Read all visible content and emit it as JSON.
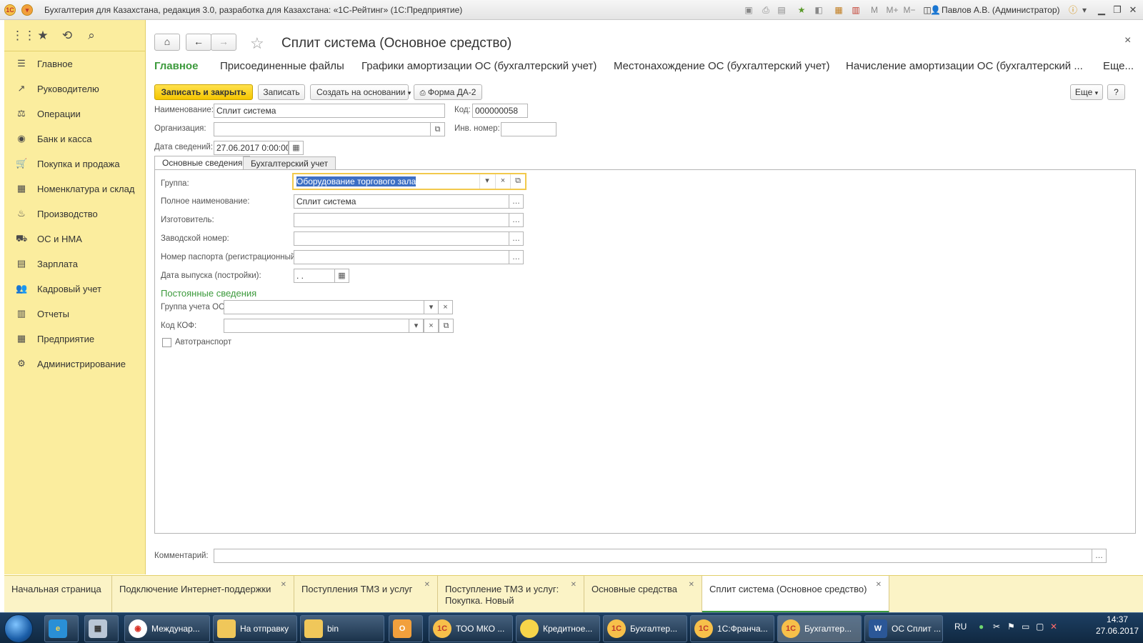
{
  "window": {
    "title": "Бухгалтерия для Казахстана, редакция 3.0, разработка для Казахстана: «1С-Рейтинг» (1С:Предприятие)",
    "user": "Павлов А.В. (Администратор)",
    "logo_text": "1С"
  },
  "sidebar": {
    "items": [
      {
        "label": "Главное",
        "icon": "menu-icon"
      },
      {
        "label": "Руководителю",
        "icon": "trend-icon"
      },
      {
        "label": "Операции",
        "icon": "operations-icon"
      },
      {
        "label": "Банк и касса",
        "icon": "bank-icon"
      },
      {
        "label": "Покупка и продажа",
        "icon": "cart-icon"
      },
      {
        "label": "Номенклатура и склад",
        "icon": "grid-icon"
      },
      {
        "label": "Производство",
        "icon": "factory-icon"
      },
      {
        "label": "ОС и НМА",
        "icon": "truck-icon"
      },
      {
        "label": "Зарплата",
        "icon": "money-icon"
      },
      {
        "label": "Кадровый учет",
        "icon": "people-icon"
      },
      {
        "label": "Отчеты",
        "icon": "chart-icon"
      },
      {
        "label": "Предприятие",
        "icon": "building-icon"
      },
      {
        "label": "Администрирование",
        "icon": "gear-icon"
      }
    ]
  },
  "form": {
    "title": "Сплит система (Основное средство)",
    "nav": [
      "Главное",
      "Присоединенные файлы",
      "Графики амортизации ОС (бухгалтерский учет)",
      "Местонахождение ОС (бухгалтерский учет)",
      "Начисление амортизации ОС (бухгалтерский ...",
      "Еще..."
    ],
    "toolbar": {
      "save_close": "Записать и закрыть",
      "save": "Записать",
      "create_based": "Создать на основании",
      "print_form": "Форма ДА-2",
      "more": "Еще",
      "help": "?"
    },
    "fields": {
      "name_label": "Наименование:",
      "name_value": "Сплит система",
      "code_label": "Код:",
      "code_value": "000000058",
      "org_label": "Организация:",
      "org_value": "",
      "inv_label": "Инв. номер:",
      "inv_value": "",
      "date_label": "Дата сведений:",
      "date_value": "27.06.2017  0:00:00"
    },
    "tabs": [
      "Основные сведения",
      "Бухгалтерский учет"
    ],
    "main_tab": {
      "group_label": "Группа:",
      "group_value": "Оборудование торгового зала",
      "full_name_label": "Полное наименование:",
      "full_name_value": "Сплит система",
      "manufacturer_label": "Изготовитель:",
      "serial_label": "Заводской номер:",
      "passport_label": "Номер паспорта (регистрационный):",
      "release_date_label": "Дата выпуска (постройки):",
      "release_date_value": " .  .",
      "section_title": "Постоянные сведения",
      "os_group_label": "Группа учета ОС:",
      "kof_label": "Код КОФ:",
      "vehicle_label": "Автотранспорт"
    },
    "comment_label": "Комментарий:"
  },
  "bottom_tabs": [
    {
      "label": "Начальная страница",
      "closable": false
    },
    {
      "label": "Подключение Интернет-поддержки",
      "closable": true
    },
    {
      "label": "Поступления ТМЗ и услуг",
      "closable": true
    },
    {
      "label": "Поступление ТМЗ и услуг: Покупка. Новый",
      "closable": true
    },
    {
      "label": "Основные средства",
      "closable": true
    },
    {
      "label": "Сплит система (Основное средство)",
      "closable": true,
      "active": true
    }
  ],
  "taskbar": {
    "items": [
      "Междунар...",
      "На отправку",
      "bin",
      "ТОО МКО ...",
      "Кредитное...",
      "Бухгалтер...",
      "1С:Франча...",
      "Бухгалтер...",
      "ОС Сплит ..."
    ],
    "lang": "RU",
    "time": "14:37",
    "date": "27.06.2017"
  },
  "colors": {
    "accent_yellow": "#fbed9e",
    "primary_button": "#f5c600",
    "active_green": "#3c9a3c"
  }
}
